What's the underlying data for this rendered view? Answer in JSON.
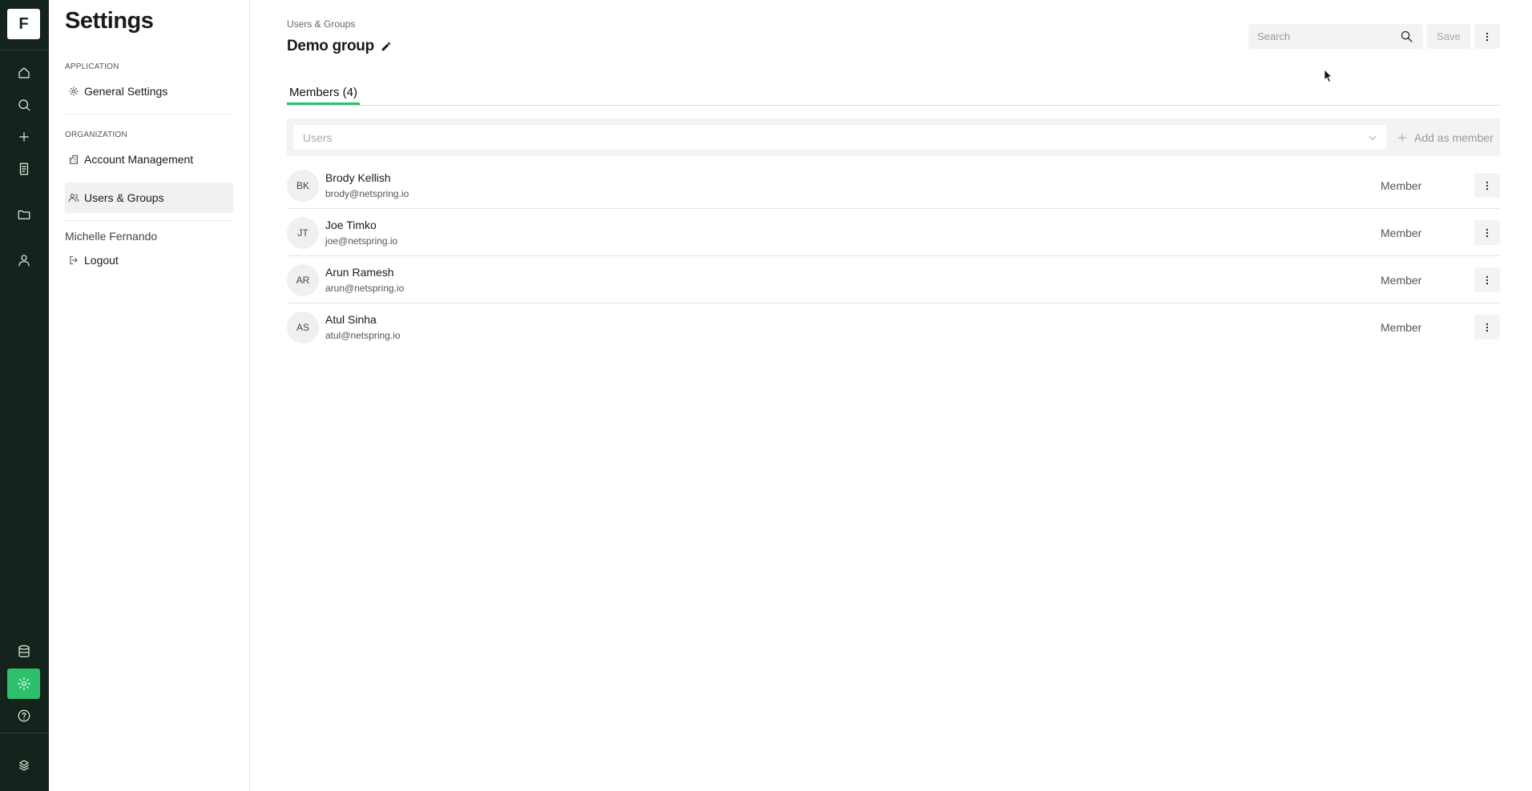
{
  "rail": {
    "logo_letter": "F",
    "items": [
      {
        "name": "home-icon"
      },
      {
        "name": "search-icon"
      },
      {
        "name": "plus-icon"
      },
      {
        "name": "notebook-icon"
      },
      {
        "name": "folder-icon"
      },
      {
        "name": "user-icon"
      },
      {
        "name": "database-icon"
      },
      {
        "name": "gear-icon",
        "active": true
      },
      {
        "name": "help-icon"
      },
      {
        "name": "brand-icon"
      }
    ],
    "accent_color": "#2dbf6c",
    "background_color": "#14241c"
  },
  "settings": {
    "title": "Settings",
    "application_label": "APPLICATION",
    "general_settings": "General Settings",
    "organization_label": "ORGANIZATION",
    "account_management": "Account Management",
    "users_groups": "Users & Groups",
    "user_name": "Michelle Fernando",
    "logout": "Logout"
  },
  "main": {
    "breadcrumb": "Users & Groups",
    "title": "Demo group",
    "search_placeholder": "Search",
    "save_label": "Save",
    "tab_label": "Members (4)",
    "users_placeholder": "Users",
    "add_member_label": "Add as member",
    "members": [
      {
        "initials": "BK",
        "name": "Brody Kellish",
        "email": "brody@netspring.io",
        "role": "Member"
      },
      {
        "initials": "JT",
        "name": "Joe Timko",
        "email": "joe@netspring.io",
        "role": "Member"
      },
      {
        "initials": "AR",
        "name": "Arun Ramesh",
        "email": "arun@netspring.io",
        "role": "Member"
      },
      {
        "initials": "AS",
        "name": "Atul Sinha",
        "email": "atul@netspring.io",
        "role": "Member"
      }
    ]
  }
}
